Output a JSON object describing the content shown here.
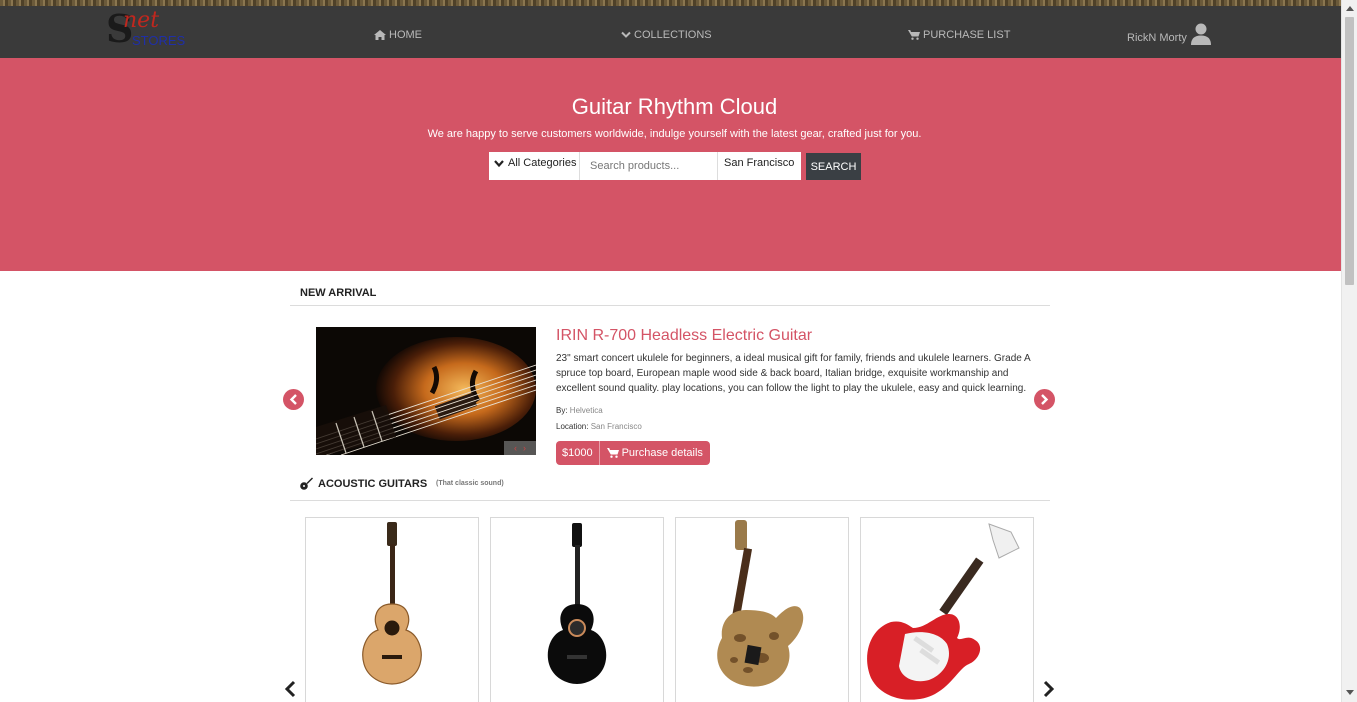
{
  "brand": {
    "logo_s": "S",
    "logo_net": "net",
    "logo_stores": "STORES"
  },
  "nav": {
    "home": "HOME",
    "collections": "COLLECTIONS",
    "purchase_list": "PURCHASE LIST",
    "user_name": "RickN Morty"
  },
  "hero": {
    "title": "Guitar Rhythm Cloud",
    "subtitle": "We are happy to serve customers worldwide, indulge yourself with the latest gear, crafted just for you.",
    "category": "All Categories",
    "search_placeholder": "Search products...",
    "location": "San Francisco",
    "search_button": "SEARCH"
  },
  "new_arrival": {
    "heading": "NEW ARRIVAL",
    "product": {
      "title": "IRIN R-700 Headless Electric Guitar",
      "description": "23\" smart concert ukulele for beginners, a ideal musical gift for family, friends and ukulele learners. Grade A spruce top board, European maple wood side & back board, Italian bridge, exquisite workmanship and excellent sound quality. play locations, you can follow the light to play the ukulele, easy and quick learning.",
      "by_label": "By:",
      "by_value": "Helvetica",
      "location_label": "Location:",
      "location_value": "San Francisco",
      "price": "$1000",
      "details_label": "Purchase details"
    }
  },
  "acoustic": {
    "heading": "ACOUSTIC GUITARS",
    "tagline": "(That classic sound)",
    "products": [
      {
        "name": "natural-classical-guitar",
        "icon": "classical-guitar-natural"
      },
      {
        "name": "black-classical-guitar",
        "icon": "classical-guitar-black"
      },
      {
        "name": "burl-bass-guitar",
        "icon": "bass-guitar-burl"
      },
      {
        "name": "red-electric-guitar",
        "icon": "electric-guitar-red"
      }
    ]
  },
  "colors": {
    "accent": "#d45466",
    "navbar": "#3a3a3a",
    "button_dark": "#3a3f44"
  }
}
